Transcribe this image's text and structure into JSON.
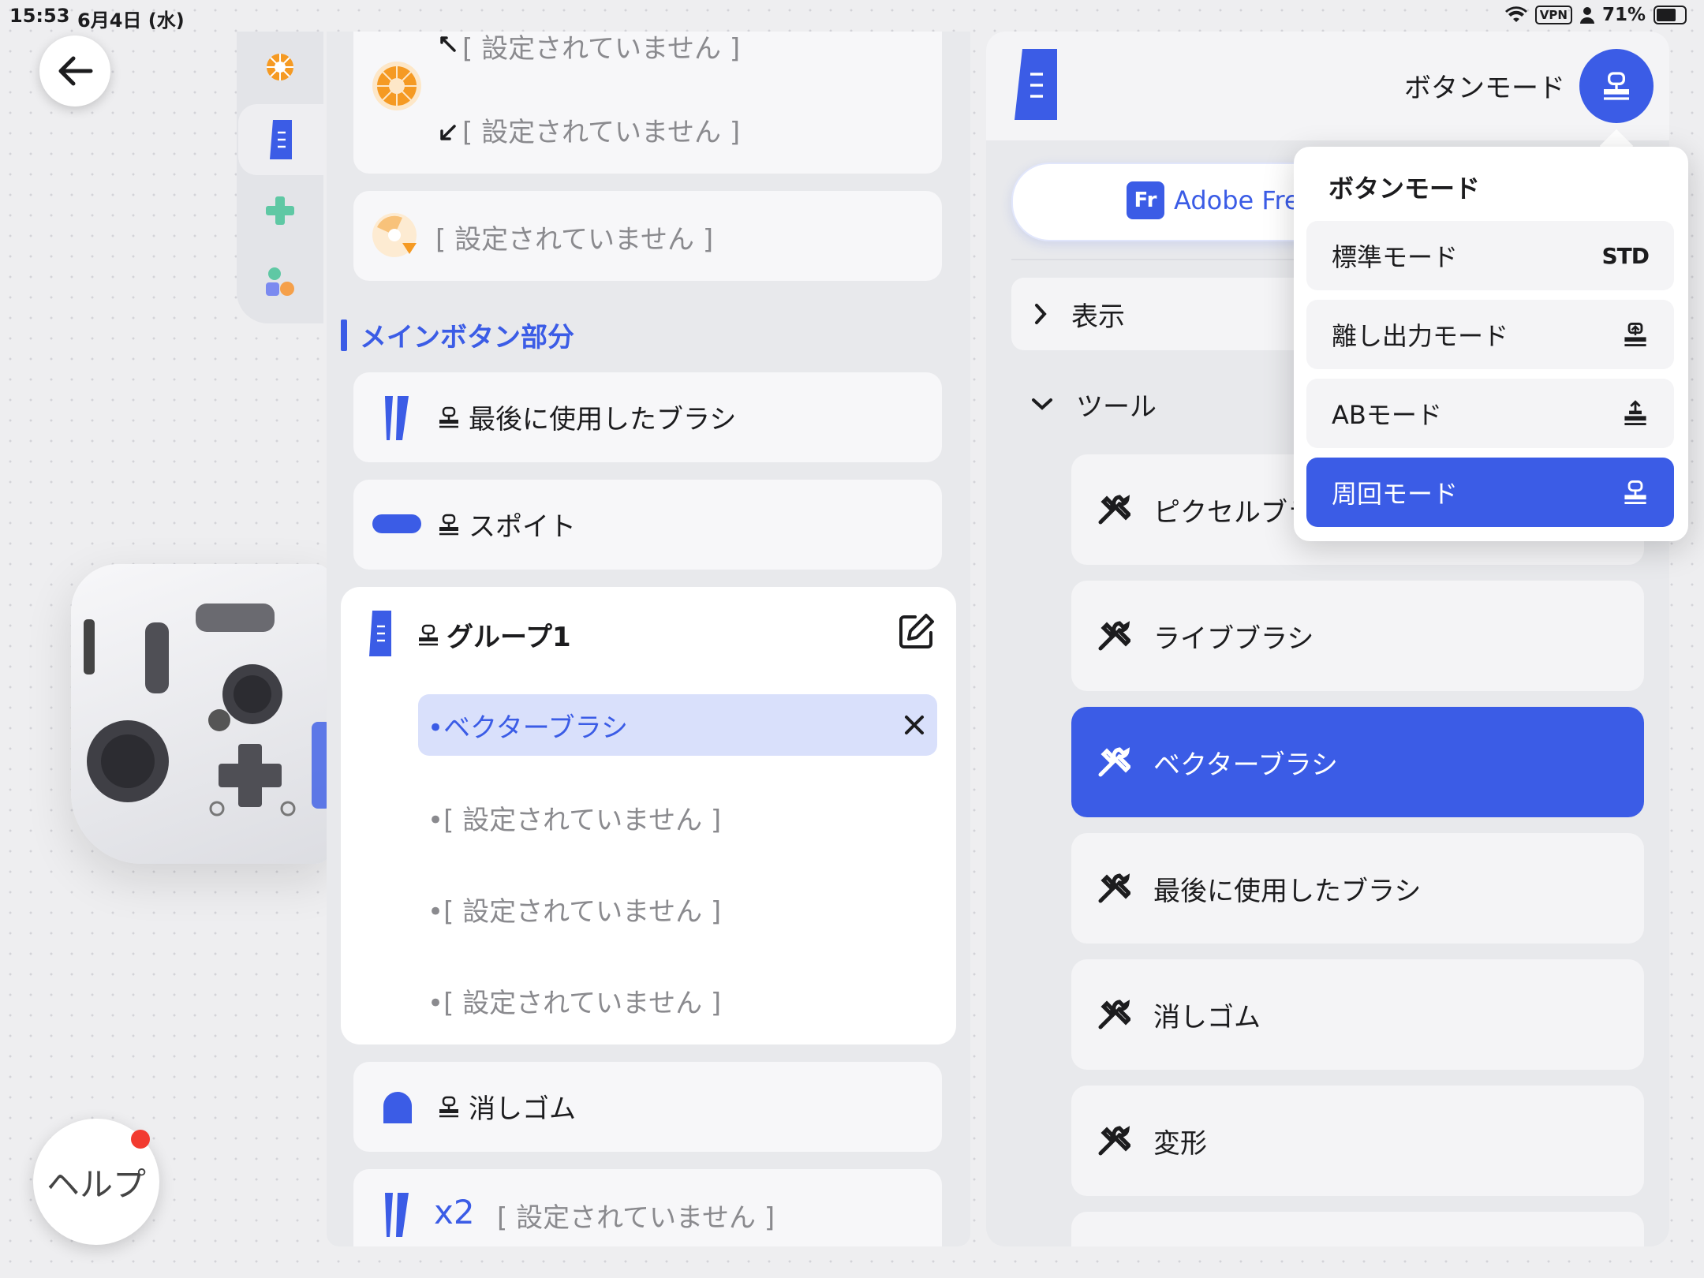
{
  "status_bar": {
    "time": "15:53",
    "date": "6月4日 (水)",
    "vpn": "VPN",
    "battery": "71%"
  },
  "help": {
    "label": "ヘルプ"
  },
  "top_partial": {
    "arrow_up_text": "[ 設定されていません ]",
    "arrow_down_text": "[ 設定されていません ]"
  },
  "card_dial_fan": {
    "text": "[ 設定されていません ]"
  },
  "section": {
    "title": "メインボタン部分"
  },
  "main_buttons": [
    {
      "label": "最後に使用したブラシ"
    },
    {
      "label": "スポイト"
    }
  ],
  "group": {
    "title": "グループ1",
    "items": [
      {
        "label": "ベクターブラシ",
        "selected": true
      },
      {
        "label": "[ 設定されていません ]"
      },
      {
        "label": "[ 設定されていません ]"
      },
      {
        "label": "[ 設定されていません ]"
      }
    ]
  },
  "eraser_button": {
    "label": "消しゴム"
  },
  "x2_button": {
    "multiplier": "x2",
    "label": "[ 設定されていません ]"
  },
  "right_panel": {
    "mode_label": "ボタンモード",
    "app_name": "Adobe Fresco",
    "app_icon": "Fr",
    "sections": [
      {
        "label": "表示",
        "expanded": false
      },
      {
        "label": "ツール",
        "expanded": true
      }
    ],
    "tools": [
      {
        "label": "ピクセルブラシ"
      },
      {
        "label": "ライブブラシ"
      },
      {
        "label": "ベクターブラシ",
        "selected": true
      },
      {
        "label": "最後に使用したブラシ"
      },
      {
        "label": "消しゴム"
      },
      {
        "label": "変形"
      }
    ]
  },
  "popover": {
    "title": "ボタンモード",
    "modes": [
      {
        "label": "標準モード",
        "badge": "STD",
        "icon": "std-badge"
      },
      {
        "label": "離し出力モード",
        "icon": "release-output-icon"
      },
      {
        "label": "ABモード",
        "icon": "ab-mode-icon"
      },
      {
        "label": "周回モード",
        "icon": "cycle-mode-icon",
        "selected": true
      }
    ]
  },
  "colors": {
    "accent": "#3b5ce6",
    "selected_bg": "#d9e0fb",
    "orange": "#f59a23",
    "notification": "#f23b30"
  }
}
